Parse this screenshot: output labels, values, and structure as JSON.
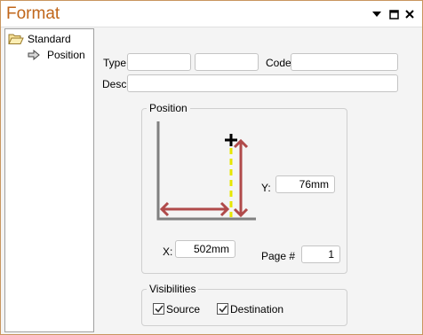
{
  "window": {
    "title": "Format"
  },
  "titlebar_icons": [
    "dropdown-arrow-icon",
    "restore-icon",
    "close-icon"
  ],
  "tree": {
    "items": [
      {
        "label": "Standard",
        "icon": "folder-open-icon"
      },
      {
        "label": "Position",
        "icon": "arrow-right-icon"
      }
    ]
  },
  "form": {
    "type_label": "Type:",
    "type_value_1": "",
    "type_value_2": "",
    "code_label": "Code:",
    "code_value": "",
    "desc_label": "Desc:",
    "desc_value": ""
  },
  "position_group": {
    "title": "Position",
    "y_label": "Y:",
    "y_value": "76mm",
    "x_label": "X:",
    "x_value": "502mm",
    "page_label": "Page #",
    "page_value": "1"
  },
  "visibilities_group": {
    "title": "Visibilities",
    "source_label": "Source",
    "source_checked": true,
    "destination_label": "Destination",
    "destination_checked": true
  },
  "colors": {
    "title": "#c0661a",
    "arrow": "#b04a4a",
    "dashed_line": "#e6e600",
    "axes": "#808080"
  }
}
